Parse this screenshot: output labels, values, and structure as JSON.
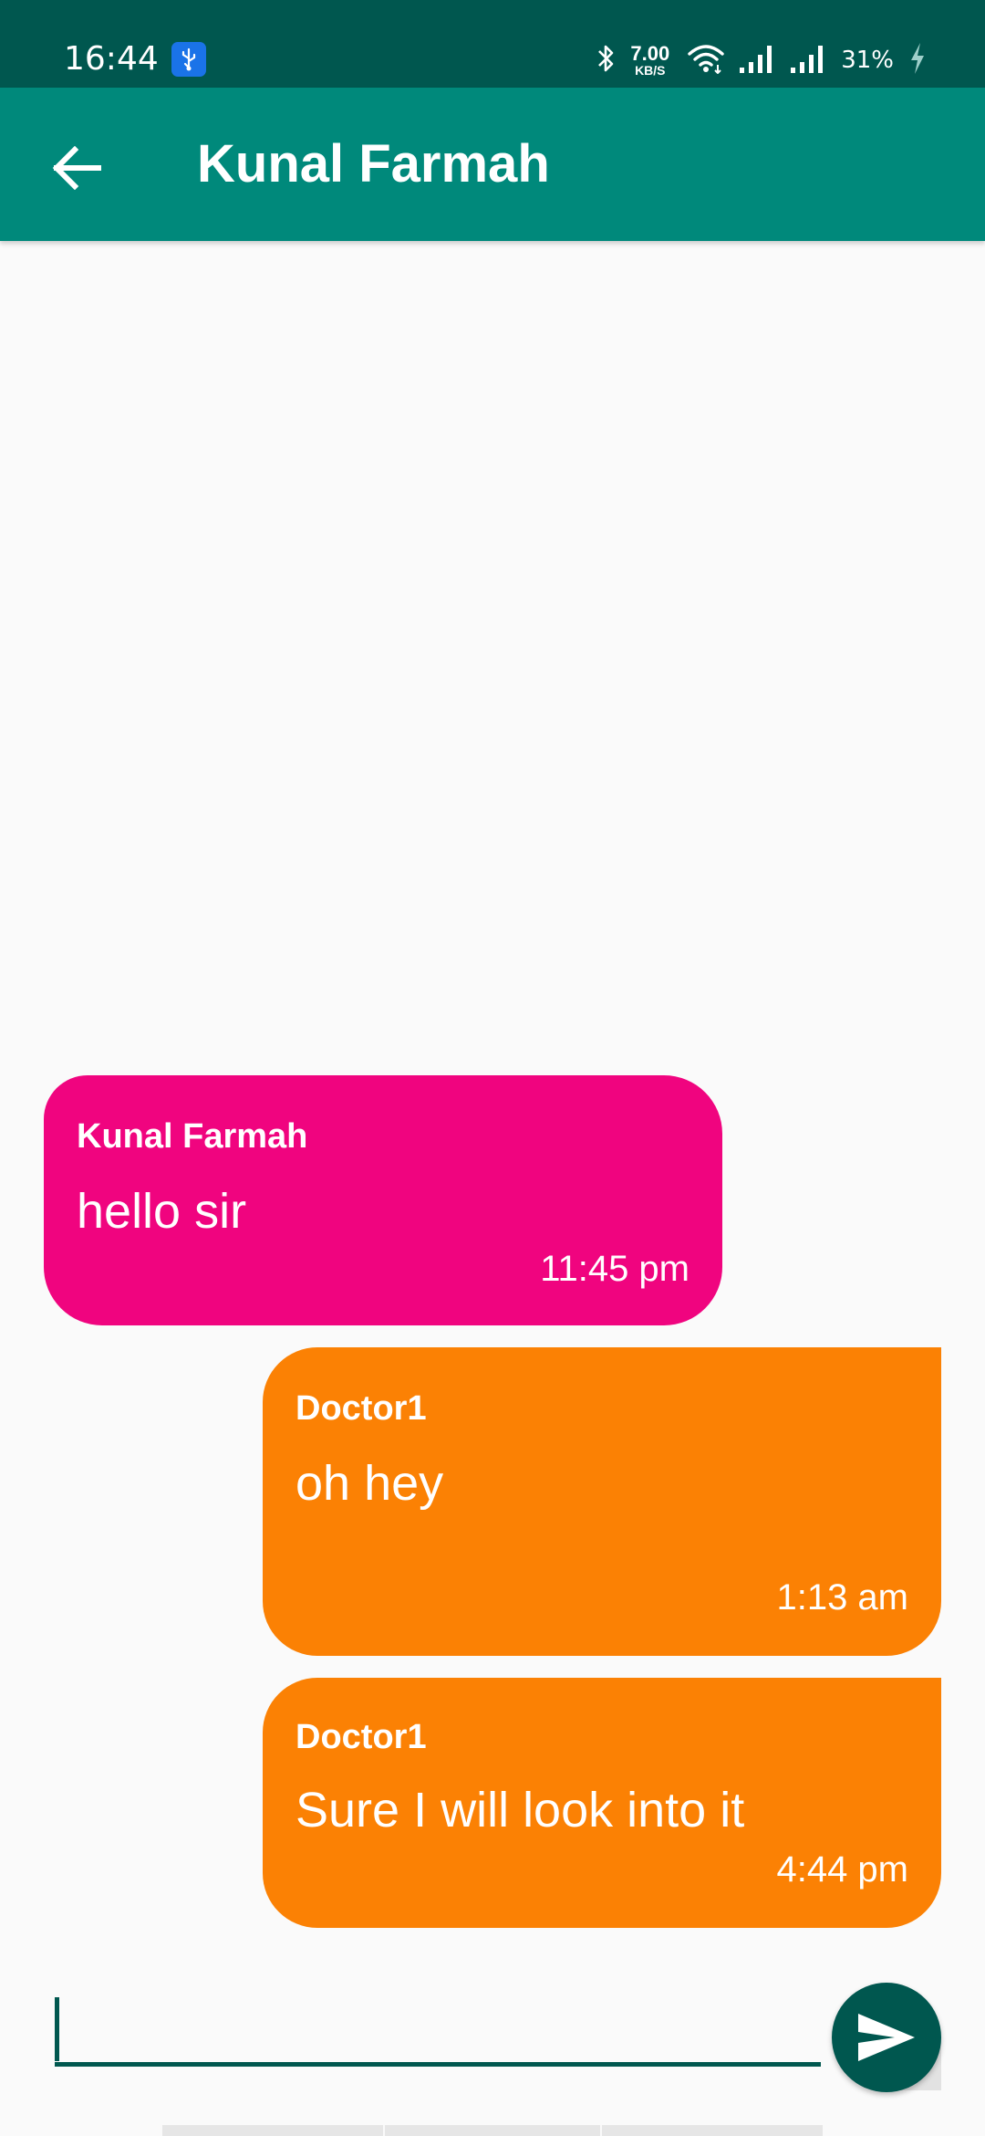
{
  "status_bar": {
    "time": "16:44",
    "net_speed_value": "7.00",
    "net_speed_unit": "KB/S",
    "battery_percent": "31%",
    "icons": [
      "usb-debug-icon",
      "bluetooth-icon",
      "wifi-icon",
      "signal-icon",
      "signal-icon",
      "charging-icon"
    ]
  },
  "app_bar": {
    "title": "Kunal Farmah",
    "back_icon": "arrow-left-icon"
  },
  "messages": [
    {
      "sender": "Kunal Farmah",
      "text": "hello sir",
      "time": "11:45 pm",
      "direction": "received",
      "color": "#f0047f"
    },
    {
      "sender": "Doctor1",
      "text": "oh hey",
      "time": "1:13 am",
      "direction": "sent",
      "color": "#fb8104"
    },
    {
      "sender": "Doctor1",
      "text": "Sure I will look into it",
      "time": "4:44 pm",
      "direction": "sent",
      "color": "#fb8104"
    }
  ],
  "composer": {
    "value": "",
    "placeholder": "",
    "send_icon": "send-icon"
  },
  "colors": {
    "status_bar": "#00574f",
    "app_bar": "#00897b",
    "received_bubble": "#f0047f",
    "sent_bubble": "#fb8104",
    "accent": "#00574f",
    "background": "#fafafa"
  }
}
